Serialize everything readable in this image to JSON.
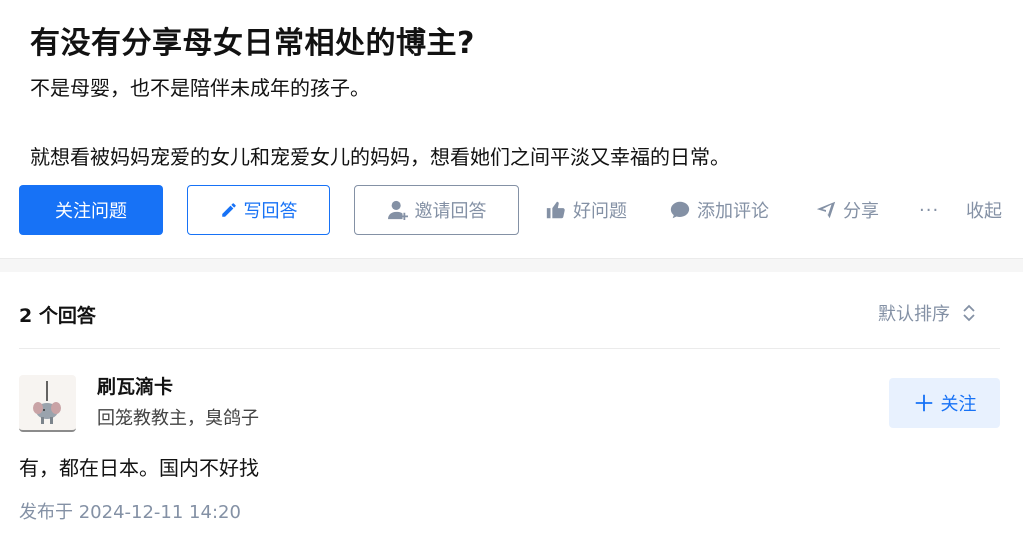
{
  "question": {
    "title": "有没有分享母女日常相处的博主?",
    "description_line1": "不是母婴，也不是陪伴未成年的孩子。",
    "description_line2": "就想看被妈妈宠爱的女儿和宠爱女儿的妈妈，想看她们之间平淡又幸福的日常。"
  },
  "actions": {
    "follow_question": "关注问题",
    "write_answer": "写回答",
    "invite_answer": "邀请回答",
    "good_question": "好问题",
    "add_comment": "添加评论",
    "share": "分享",
    "more": "···",
    "collapse": "收起"
  },
  "answers": {
    "count_label": "2 个回答",
    "sort_label": "默认排序"
  },
  "answer": {
    "author_name": "刷瓦滴卡",
    "author_bio": "回笼教教主，臭鸽子",
    "follow_label": "关注",
    "content": "有，都在日本。国内不好找",
    "published": "发布于 2024-12-11 14:20"
  },
  "colors": {
    "brand_blue": "#1772f6",
    "muted_gray": "#8491a5",
    "follow_bg": "#e8f1fe"
  },
  "icons": {
    "write": "pencil-icon",
    "invite": "add-user-icon",
    "good": "thumbs-up-icon",
    "comment": "comment-bubble-icon",
    "share": "paper-plane-icon",
    "sort": "sort-chevrons-icon",
    "follow": "plus-icon"
  }
}
